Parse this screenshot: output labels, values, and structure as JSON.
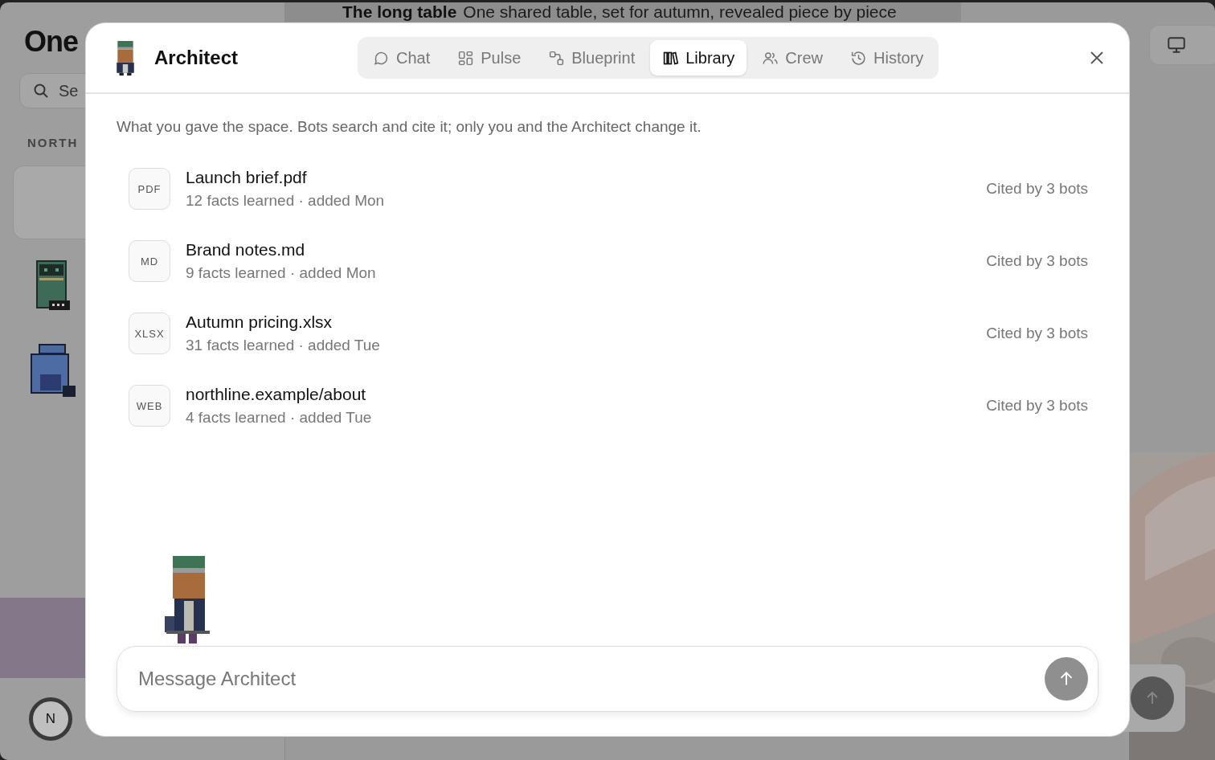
{
  "background": {
    "app_title": "One",
    "search": {
      "placeholder": "Se"
    },
    "section_label": "NORTH",
    "banner": {
      "title": "The long table",
      "subtitle": "One shared table, set for autumn, revealed piece by piece"
    },
    "user_avatar": "N"
  },
  "dialog": {
    "title": "Architect",
    "tabs": [
      {
        "label": "Chat",
        "kind": "chat",
        "selected": false
      },
      {
        "label": "Pulse",
        "kind": "pulse",
        "selected": false
      },
      {
        "label": "Blueprint",
        "kind": "blueprint",
        "selected": false
      },
      {
        "label": "Library",
        "kind": "library",
        "selected": true
      },
      {
        "label": "Crew",
        "kind": "crew",
        "selected": false
      },
      {
        "label": "History",
        "kind": "history",
        "selected": false
      }
    ],
    "intro": "What you gave the space. Bots search and cite it; only you and the Architect change it.",
    "sources": [
      {
        "type": "PDF",
        "name": "Launch brief.pdf",
        "meta": "12 facts learned · added Mon",
        "cited": "Cited by 3 bots"
      },
      {
        "type": "MD",
        "name": "Brand notes.md",
        "meta": "9 facts learned · added Mon",
        "cited": "Cited by 3 bots"
      },
      {
        "type": "XLSX",
        "name": "Autumn pricing.xlsx",
        "meta": "31 facts learned · added Tue",
        "cited": "Cited by 3 bots"
      },
      {
        "type": "WEB",
        "name": "northline.example/about",
        "meta": "4 facts learned · added Tue",
        "cited": "Cited by 3 bots"
      }
    ],
    "composer": {
      "placeholder": "Message Architect"
    }
  }
}
